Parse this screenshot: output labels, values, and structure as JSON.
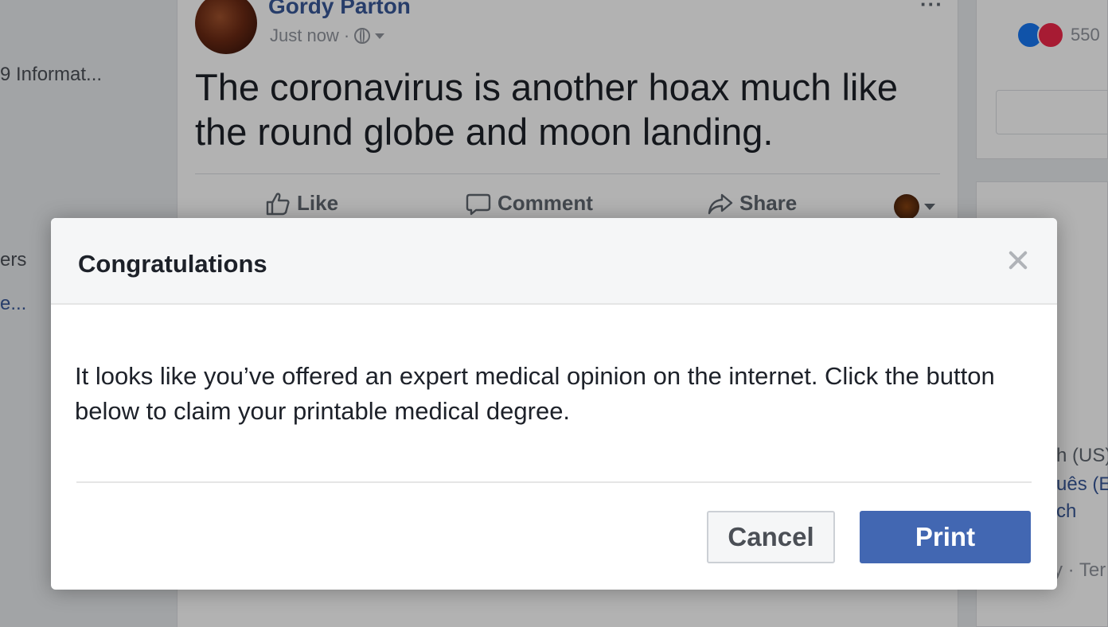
{
  "feed": {
    "left_links": [
      "9 Informat...",
      "ers",
      "e..."
    ],
    "post": {
      "author": "Gordy Parton",
      "timestamp": "Just now ·",
      "text": "The coronavirus is another hoax much like the round globe and moon landing.",
      "actions": {
        "like": "Like",
        "comment": "Comment",
        "share": "Share"
      },
      "more": "···"
    },
    "right": {
      "reaction_count": "550",
      "languages": [
        "h (US)",
        "uês (E",
        "ch",
        "y · Ter"
      ]
    }
  },
  "modal": {
    "title": "Congratulations",
    "body": "It looks like you’ve offered an expert medical opinion on the internet. Click the button below to claim your printable medical degree.",
    "cancel_label": "Cancel",
    "print_label": "Print"
  },
  "colors": {
    "brand_blue": "#4267b2",
    "link_blue": "#385898",
    "overlay": "rgba(0,0,0,0.30)"
  }
}
